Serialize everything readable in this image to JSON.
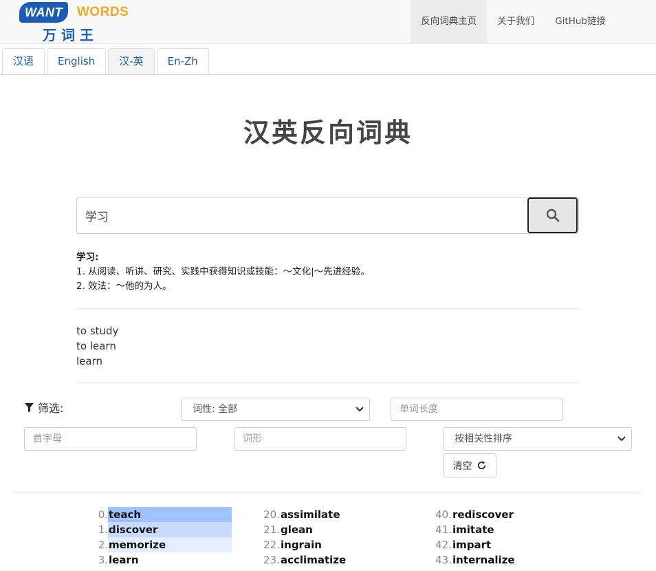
{
  "logo": {
    "badge": "WANT",
    "words": "WORDS",
    "cn": "万词王"
  },
  "nav": {
    "items": [
      "反向词典主页",
      "关于我们",
      "GitHub链接"
    ]
  },
  "tabs": [
    "汉语",
    "English",
    "汉-英",
    "En-Zh"
  ],
  "title": "汉英反向词典",
  "search": {
    "value": "学习"
  },
  "definition": {
    "headword": "学习:",
    "senses": [
      "1. 从阅读、听讲、研究、实践中获得知识或技能：～文化|～先进经验。",
      "2. 效法：～他的为人。"
    ]
  },
  "translations": [
    "to study",
    "to learn",
    "learn"
  ],
  "filters": {
    "label": "筛选:",
    "pos_select": "词性: 全部",
    "length_placeholder": "单词长度",
    "initial_placeholder": "首字母",
    "form_placeholder": "词形",
    "sort_select": "按相关性排序",
    "clear_label": "清空"
  },
  "results": {
    "col1": [
      {
        "num": "0.",
        "word": "teach",
        "highlight": "#9fc3ff"
      },
      {
        "num": "1.",
        "word": "discover",
        "highlight": "#c7dcff"
      },
      {
        "num": "2.",
        "word": "memorize",
        "highlight": "#e4eeff"
      },
      {
        "num": "3.",
        "word": "learn",
        "highlight": ""
      }
    ],
    "col2": [
      {
        "num": "20.",
        "word": "assimilate"
      },
      {
        "num": "21.",
        "word": "glean"
      },
      {
        "num": "22.",
        "word": "ingrain"
      },
      {
        "num": "23.",
        "word": "acclimatize"
      }
    ],
    "col3": [
      {
        "num": "40.",
        "word": "rediscover"
      },
      {
        "num": "41.",
        "word": "imitate"
      },
      {
        "num": "42.",
        "word": "impart"
      },
      {
        "num": "43.",
        "word": "internalize"
      }
    ]
  }
}
